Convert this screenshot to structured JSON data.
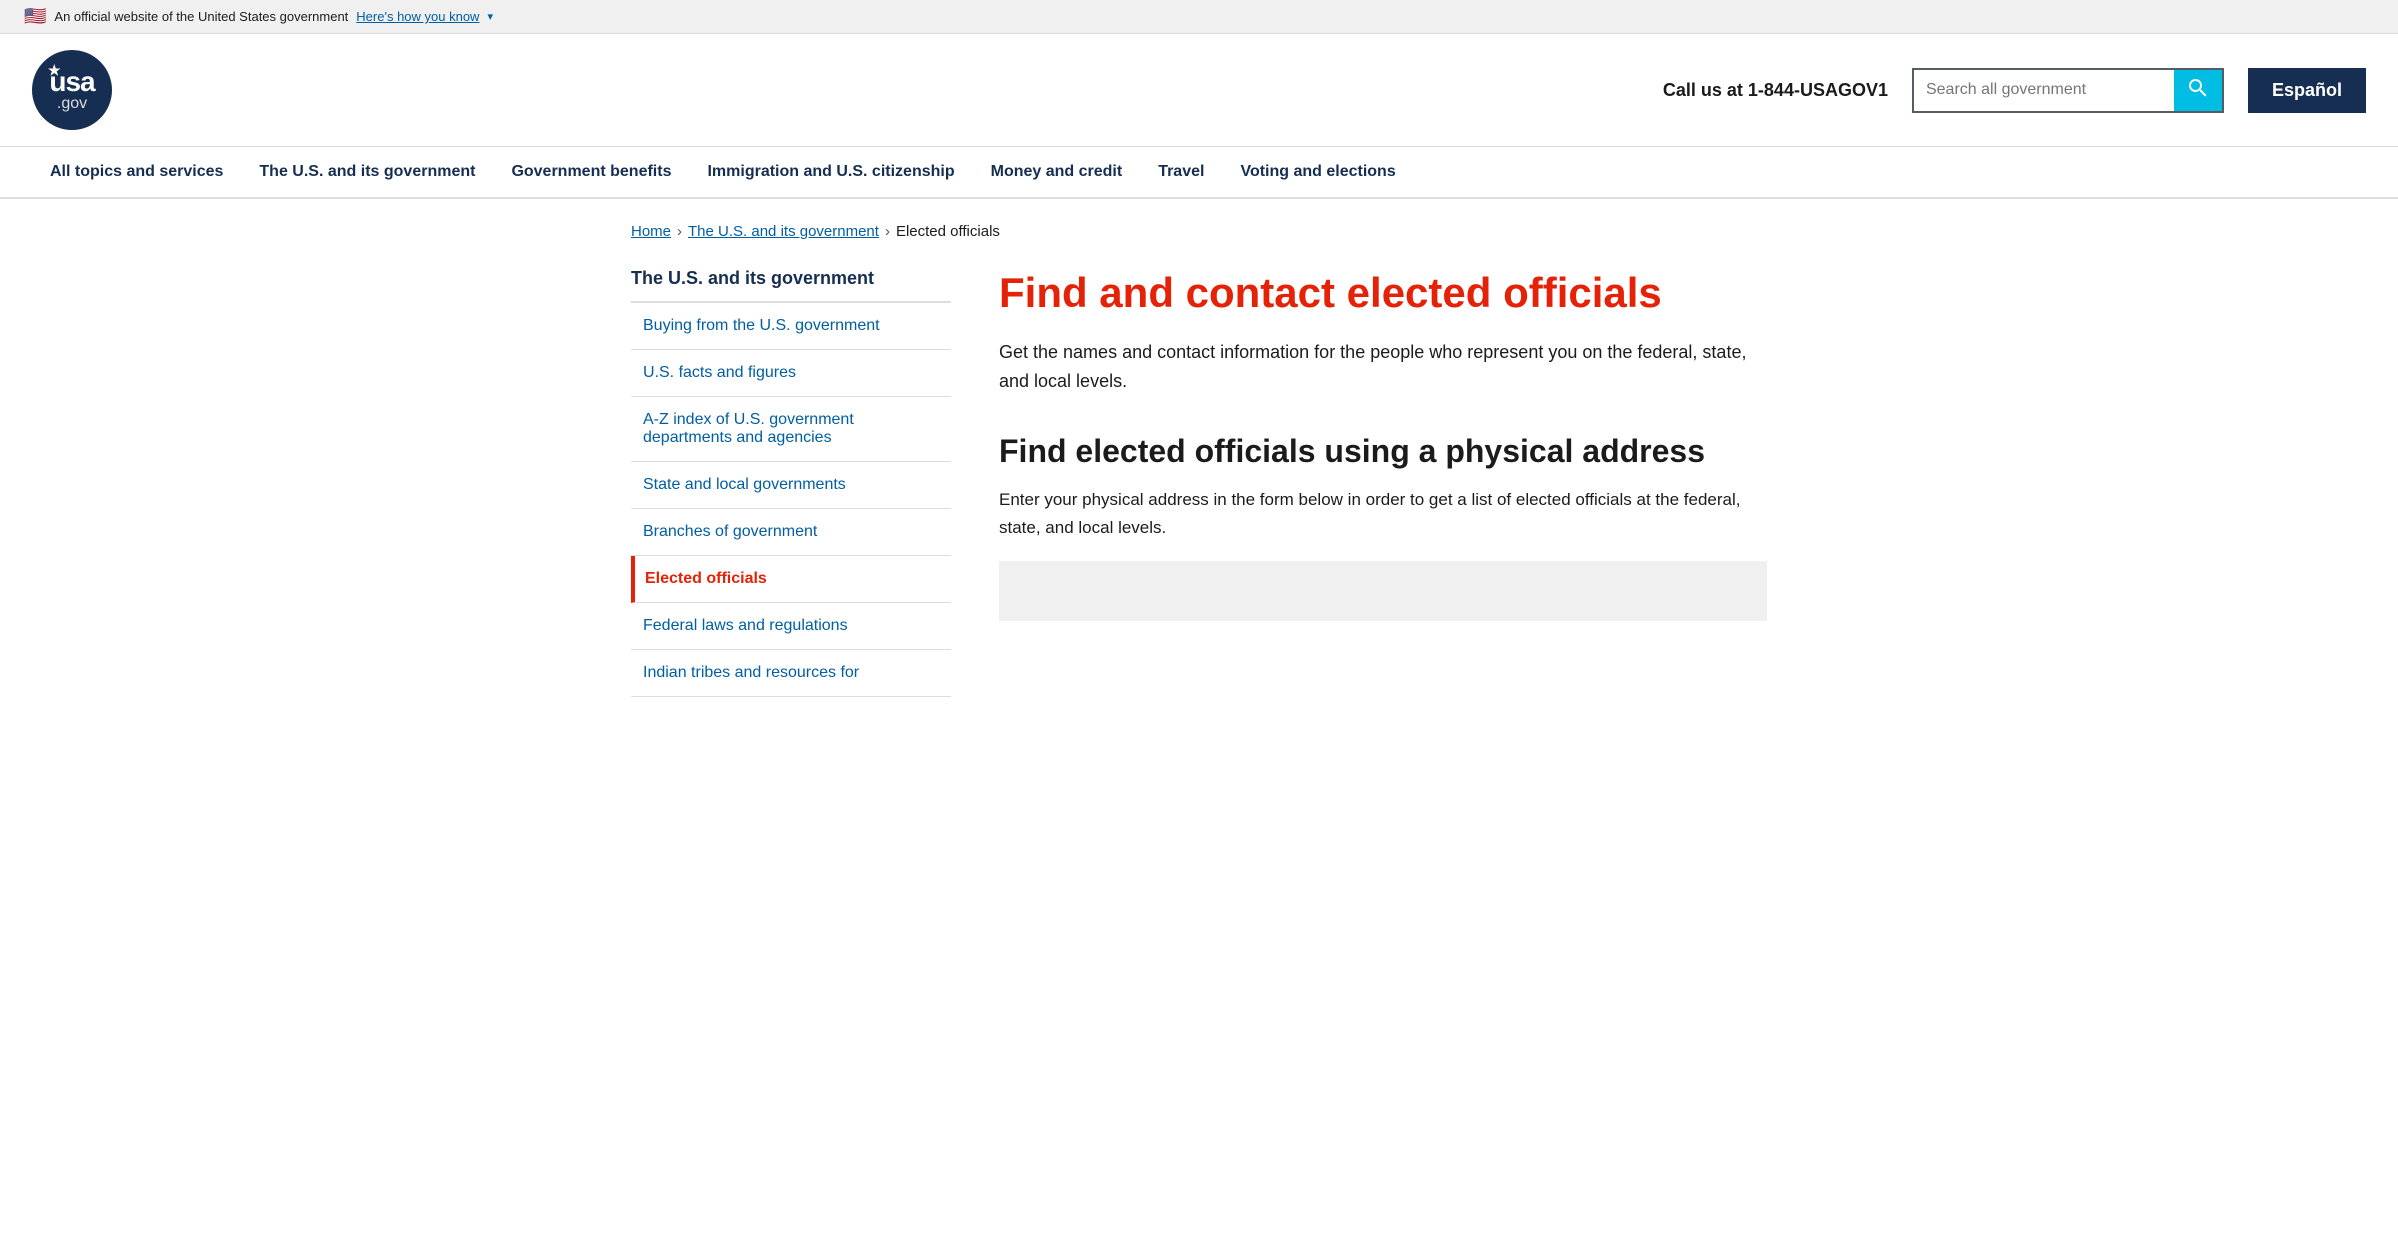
{
  "banner": {
    "flag": "🇺🇸",
    "official_text": "An official website of the United States government",
    "link_text": "Here's how you know",
    "link_caret": "▾"
  },
  "header": {
    "logo": {
      "star": "★",
      "usa": "usa",
      "gov": ".gov"
    },
    "phone": "Call us at 1-844-USAGOV1",
    "search_placeholder": "Search all government",
    "espanol_label": "Español"
  },
  "nav": {
    "items": [
      {
        "label": "All topics and services",
        "href": "#",
        "active": false
      },
      {
        "label": "The U.S. and its government",
        "href": "#",
        "active": true
      },
      {
        "label": "Government benefits",
        "href": "#",
        "active": false
      },
      {
        "label": "Immigration and U.S. citizenship",
        "href": "#",
        "active": false
      },
      {
        "label": "Money and credit",
        "href": "#",
        "active": false
      },
      {
        "label": "Travel",
        "href": "#",
        "active": false
      },
      {
        "label": "Voting and elections",
        "href": "#",
        "active": false
      }
    ]
  },
  "breadcrumb": {
    "home": "Home",
    "section": "The U.S. and its government",
    "current": "Elected officials"
  },
  "sidebar": {
    "title": "The U.S. and its government",
    "items": [
      {
        "label": "Buying from the U.S. government",
        "active": false
      },
      {
        "label": "U.S. facts and figures",
        "active": false
      },
      {
        "label": "A-Z index of U.S. government departments and agencies",
        "active": false
      },
      {
        "label": "State and local governments",
        "active": false
      },
      {
        "label": "Branches of government",
        "active": false
      },
      {
        "label": "Elected officials",
        "active": true
      },
      {
        "label": "Federal laws and regulations",
        "active": false
      },
      {
        "label": "Indian tribes and resources for",
        "active": false
      }
    ]
  },
  "main": {
    "page_title": "Find and contact elected officials",
    "page_description": "Get the names and contact information for the people who represent you on the federal, state, and local levels.",
    "section1_heading": "Find elected officials using a physical address",
    "section1_description": "Enter your physical address in the form below in order to get a list of elected officials at the federal, state, and local levels."
  }
}
